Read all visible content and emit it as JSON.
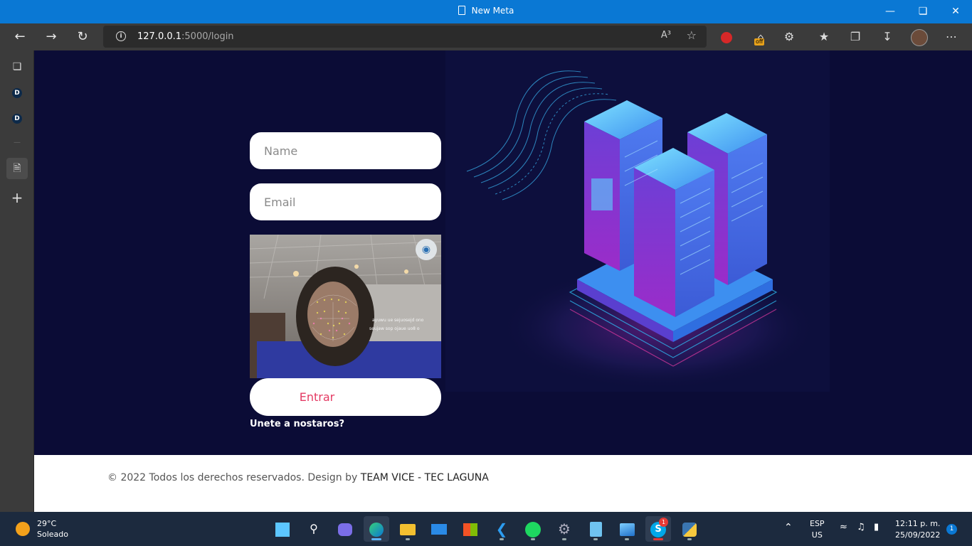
{
  "window": {
    "title": "New Meta",
    "controls": [
      "minimize",
      "restore",
      "close"
    ]
  },
  "browser": {
    "url_host": "127.0.0.1",
    "url_path": ":5000/login",
    "read_aloud_label": "A³",
    "ext_badge": "off"
  },
  "sidebar": {
    "items": [
      {
        "icon": "tabs-icon"
      },
      {
        "label": "D"
      },
      {
        "label": "D"
      },
      {
        "icon": "page-icon"
      },
      {
        "label": "+"
      }
    ]
  },
  "form": {
    "name_placeholder": "Name",
    "email_placeholder": "Email",
    "submit_label": "Entrar",
    "join_link": "Unete a nostaros?"
  },
  "camera_overlay": {
    "mirrored_text_1": "ayuwu ue sejuosejd ono",
    "mirrored_text_2": "seujaw sop ojaue uo8 o"
  },
  "footer": {
    "copyright": "© 2022 Todos los derechos reservados. Design by",
    "team": "TEAM VICE - TEC LAGUNA"
  },
  "taskbar": {
    "weather_temp": "29°C",
    "weather_condition": "Soleado",
    "lang_top": "ESP",
    "lang_bottom": "US",
    "time": "12:11 p. m.",
    "date": "25/09/2022",
    "notification_count": "1",
    "skype_badge": "1"
  },
  "colors": {
    "titlebar": "#0a78d4",
    "page_bg": "#0b0c36",
    "accent_text": "#e43a63"
  }
}
